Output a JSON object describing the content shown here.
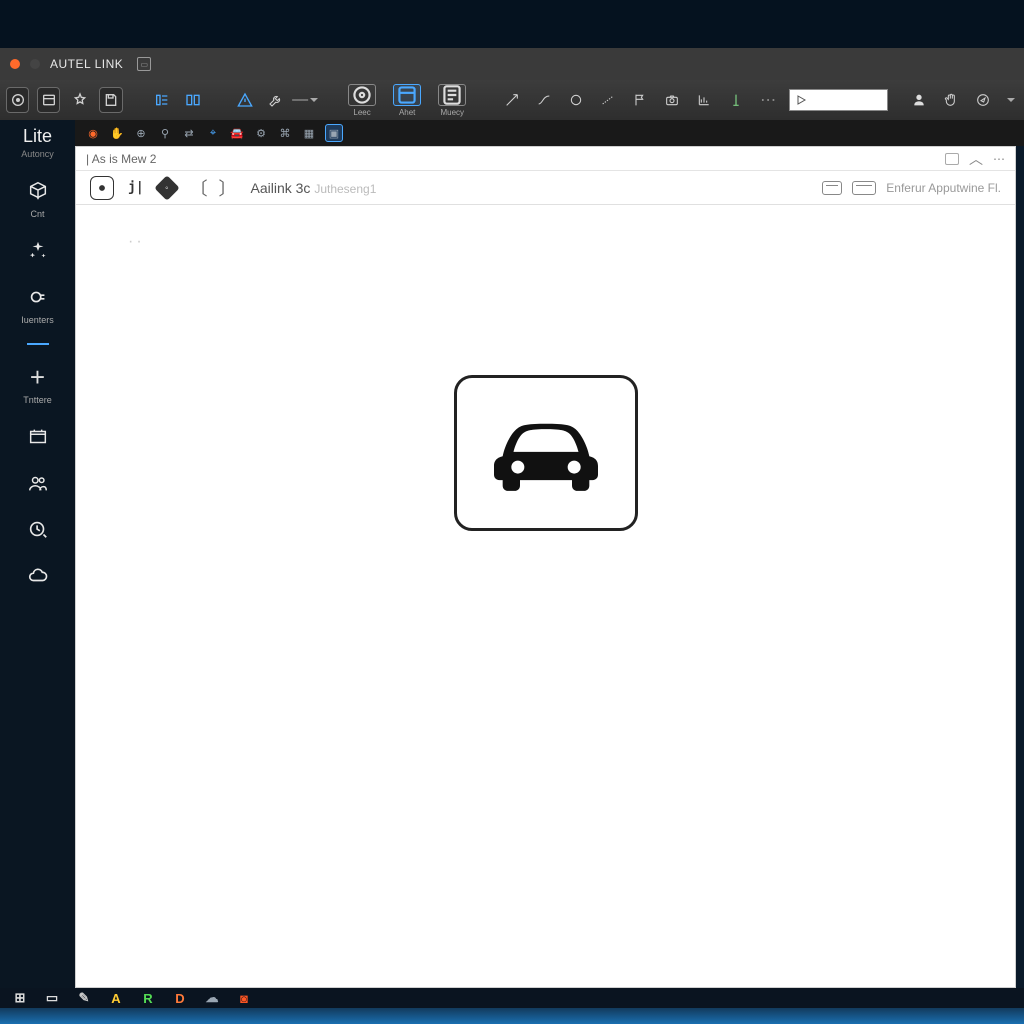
{
  "titlebar": {
    "app_name": "AUTEL LINK"
  },
  "toolbar": {
    "labeled": [
      {
        "label": "Leec"
      },
      {
        "label": "Ahet"
      },
      {
        "label": "Muecy"
      }
    ]
  },
  "sidebar": {
    "title": "Lite",
    "subtitle": "Autoncy",
    "items": [
      {
        "label": "Cnt"
      },
      {
        "label": ""
      },
      {
        "label": "Iuenters"
      },
      {
        "label": ""
      },
      {
        "label": "Tnttere"
      }
    ]
  },
  "document": {
    "tab_label": "| As is Mew 2",
    "subbar_title": "Aailink 3c",
    "subbar_dim": "Jutheseng1",
    "right_hint": "Enferur Apputwine Fl."
  },
  "taskbar": {
    "items": [
      {
        "glyph": "⊞",
        "color": "#dcdcdc"
      },
      {
        "glyph": "▭",
        "color": "#dcdcdc"
      },
      {
        "glyph": "✎",
        "color": "#c8c8c8"
      },
      {
        "glyph": "A",
        "color": "#ffcc33"
      },
      {
        "glyph": "R",
        "color": "#55dd55"
      },
      {
        "glyph": "D",
        "color": "#ff7a3a"
      },
      {
        "glyph": "☁",
        "color": "#9aa6b2"
      },
      {
        "glyph": "◙",
        "color": "#ff5522"
      }
    ]
  }
}
